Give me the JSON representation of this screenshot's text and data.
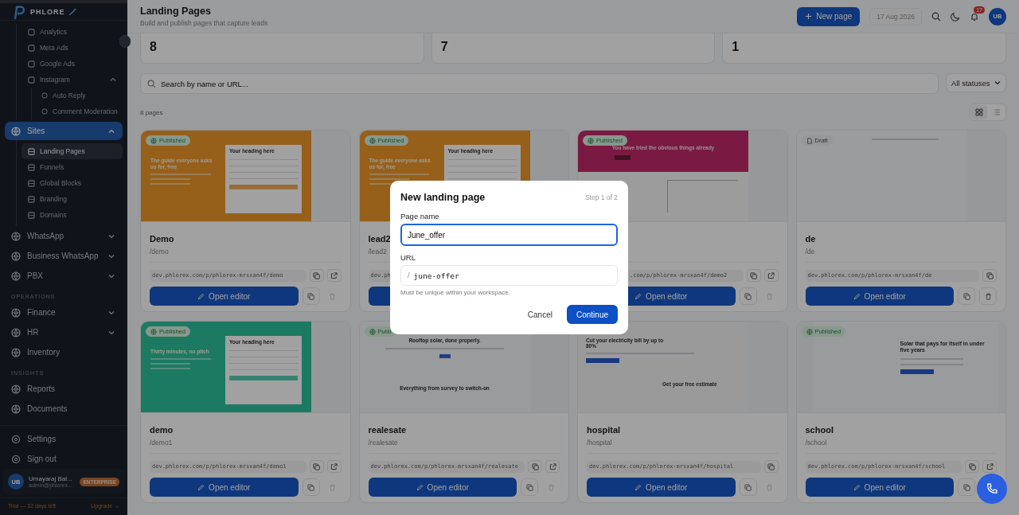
{
  "sidebar": {
    "logo": "PHLORE",
    "partial_children": [
      {
        "label": "Analytics",
        "selected": false
      },
      {
        "label": "Meta Ads",
        "selected": false
      },
      {
        "label": "Google Ads",
        "selected": false
      },
      {
        "label": "Instagram",
        "selected": false,
        "expanded": true,
        "children": [
          {
            "label": "Auto Reply",
            "selected": false
          },
          {
            "label": "Comment Moderation",
            "selected": false
          }
        ]
      }
    ],
    "sections": [
      {
        "items": [
          {
            "label": "Sites",
            "selected": true,
            "expanded": true,
            "children": [
              {
                "label": "Landing Pages",
                "selected": true
              },
              {
                "label": "Funnels",
                "selected": false
              },
              {
                "label": "Global Blocks",
                "selected": false
              },
              {
                "label": "Branding",
                "selected": false
              },
              {
                "label": "Domains",
                "selected": false
              }
            ]
          },
          {
            "label": "WhatsApp",
            "selected": false,
            "expanded": false
          },
          {
            "label": "Business WhatsApp",
            "selected": false,
            "expanded": false
          },
          {
            "label": "PBX",
            "selected": false,
            "expanded": false
          }
        ]
      },
      {
        "heading": "OPERATIONS",
        "items": [
          {
            "label": "Finance",
            "selected": false,
            "expanded": false
          },
          {
            "label": "HR",
            "selected": false,
            "expanded": false
          },
          {
            "label": "Inventory",
            "selected": false
          }
        ]
      },
      {
        "heading": "INSIGHTS",
        "items": [
          {
            "label": "Reports",
            "selected": false
          },
          {
            "label": "Documents",
            "selected": false
          }
        ]
      }
    ],
    "footer_items": [
      {
        "label": "Settings"
      },
      {
        "label": "Sign out"
      }
    ],
    "user": {
      "initials": "UB",
      "name": "Umayaraj Bal...",
      "email": "admin@phlorex...",
      "plan": "ENTERPRISE"
    },
    "trial": "Trial — 32 days left",
    "upgrade": "Upgrade →"
  },
  "header": {
    "title": "Landing Pages",
    "subtitle": "Build and publish pages that capture leads",
    "new_page_button": "New page",
    "date": "17 Aug 2026",
    "notifications": "17",
    "avatar": "UB"
  },
  "stats": [
    {
      "value": "8"
    },
    {
      "value": "7"
    },
    {
      "value": "1"
    }
  ],
  "search": {
    "placeholder": "Search by name or URL..."
  },
  "status_filter": "All statuses",
  "count": "8 pages",
  "views": [
    {
      "kind": "grid",
      "selected": true
    },
    {
      "kind": "list",
      "selected": false
    }
  ],
  "cards": [
    {
      "status": {
        "kind": "published",
        "label": "Published"
      },
      "preview": {
        "kind": "form",
        "color": "#96601a",
        "headline": "The guide everyone asks us for, free",
        "form_heading": "Your heading here"
      },
      "name": "Demo",
      "path": "/demo",
      "url": "dev.phlorex.com/p/phlorex-mrsxan4f/demo",
      "button": "Open editor"
    },
    {
      "status": {
        "kind": "published",
        "label": "Published"
      },
      "preview": {
        "kind": "form",
        "color": "#96601a",
        "headline": "The guide everyone asks us for, free",
        "form_heading": "Your heading here"
      },
      "name": "lead2",
      "path": "/lead2",
      "url": "dev.ph"
    },
    {
      "status": {
        "kind": "published",
        "label": "Published"
      },
      "preview": {
        "kind": "banner",
        "color": "#7a1a42",
        "headline": "You have tried the obvious things already"
      },
      "url": ".com/p/phlorex-mrsxan4f/demo2",
      "button": "Open editor"
    },
    {
      "status": {
        "kind": "draft",
        "label": "Draft"
      },
      "preview": {
        "kind": "blank"
      },
      "name": "de",
      "path": "/de",
      "url": "dev.phlorex.com/p/phlorex-mrsxan4f/de",
      "button": "Open editor"
    },
    {
      "status": {
        "kind": "published",
        "label": "Published"
      },
      "preview": {
        "kind": "form",
        "color": "#1d7a62",
        "headline": "Thirty minutes, no pitch",
        "form_heading": "Your heading here"
      },
      "name": "demo",
      "path": "/demo1",
      "url": "dev.phlorex.com/p/phlorex-mrsxan4f/demo1",
      "button": "Open editor"
    },
    {
      "status": {
        "kind": "published",
        "label": "Publi"
      },
      "preview": {
        "kind": "hero",
        "headline": "Rooftop solar, done properly.",
        "section": "Everything from survey to switch-on"
      },
      "name": "realesate",
      "path": "/realesate",
      "url": "dev.phlorex.com/p/phlorex-mrsxan4f/realesate",
      "button": "Open editor"
    },
    {
      "preview": {
        "kind": "offer",
        "headline": "Cut your electricity bill by up to 80%",
        "section": "Get your free estimate"
      },
      "name": "hospital",
      "path": "/hospital",
      "url": "dev.phlorex.com/p/phlorex-mrsxan4f/hospital",
      "button": "Open editor"
    },
    {
      "status": {
        "kind": "published",
        "label": "Published"
      },
      "preview": {
        "kind": "solar",
        "headline": "Solar that pays for itself in under five years"
      },
      "name": "school",
      "path": "/school",
      "url": "dev.phlorex.com/p/phlorex-mrsxan4f/school",
      "button": "Open editor"
    }
  ],
  "modal": {
    "title": "New landing page",
    "step": "Step 1 of 2",
    "fields": [
      {
        "label": "Page name",
        "value": "June_offer",
        "focused": true
      },
      {
        "label": "URL",
        "prefix": "/",
        "value": "june-offer",
        "focused": false,
        "hint": "Must be unique within your workspace."
      }
    ],
    "cancel": "Cancel",
    "continue": "Continue"
  }
}
